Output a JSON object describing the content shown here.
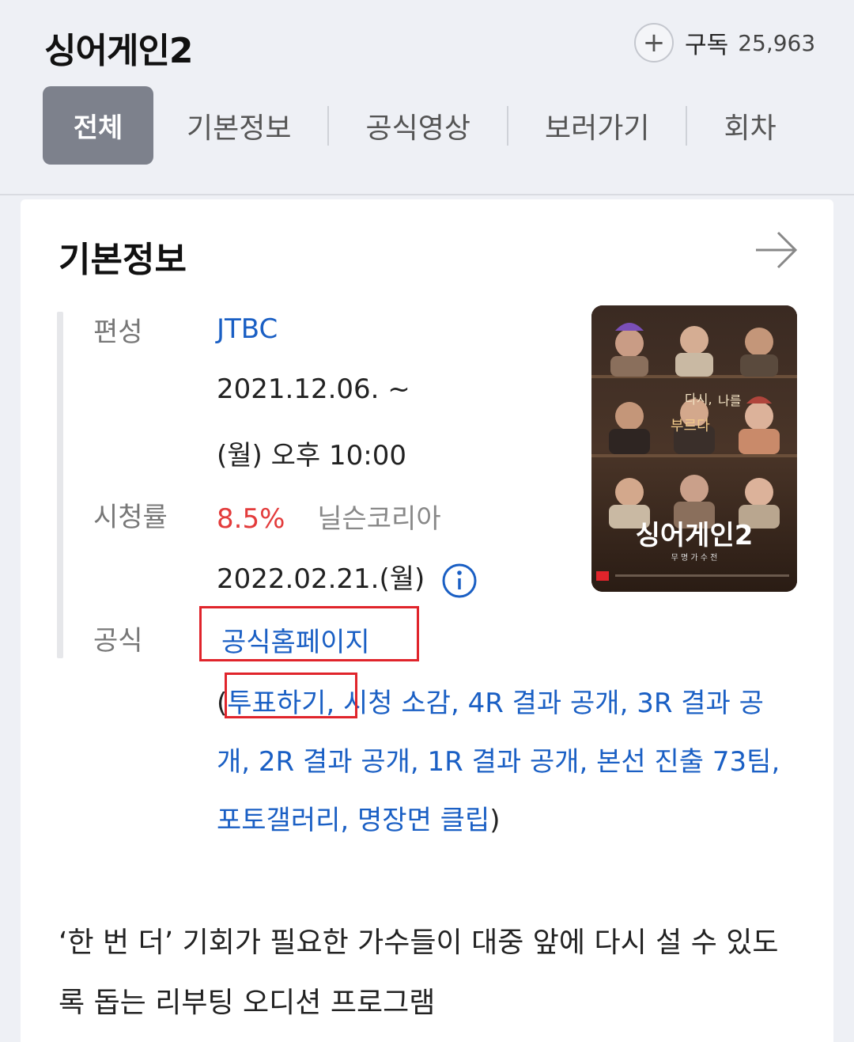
{
  "header": {
    "title": "싱어게인2",
    "subscribe_label": "구독",
    "subscribe_count": "25,963"
  },
  "tabs": [
    "전체",
    "기본정보",
    "공식영상",
    "보러가기",
    "회차"
  ],
  "basic_info": {
    "section_title": "기본정보",
    "broadcast_label": "편성",
    "broadcast_channel": "JTBC",
    "start_date": "2021.12.06. ~",
    "air_time": "(월) 오후 10:00",
    "rating_label": "시청률",
    "rating_value": "8.5%",
    "rating_source": "닐슨코리아",
    "rating_date": "2022.02.21.(월)",
    "official_label": "공식",
    "homepage_link": "공식홈페이지",
    "sub_links": [
      "투표하기",
      "시청 소감",
      "4R 결과 공개",
      "3R 결과 공개",
      "2R 결과 공개",
      "1R 결과 공개",
      "본선 진출 73팀",
      "포토갤러리",
      "명장면 클립"
    ],
    "description": "‘한 번 더’ 기회가 필요한 가수들이 대중 앞에 다시 설 수 있도록 돕는 리부팅 오디션 프로그램"
  },
  "poster": {
    "title_text": "싱어게인2",
    "subtitle_text": "무명가수전",
    "tagline": "다시, 나를 부르다"
  },
  "colors": {
    "link": "#1a5fc4",
    "rating": "#e33b3b",
    "highlight": "#e0242b",
    "active_tab": "#7d818c"
  }
}
